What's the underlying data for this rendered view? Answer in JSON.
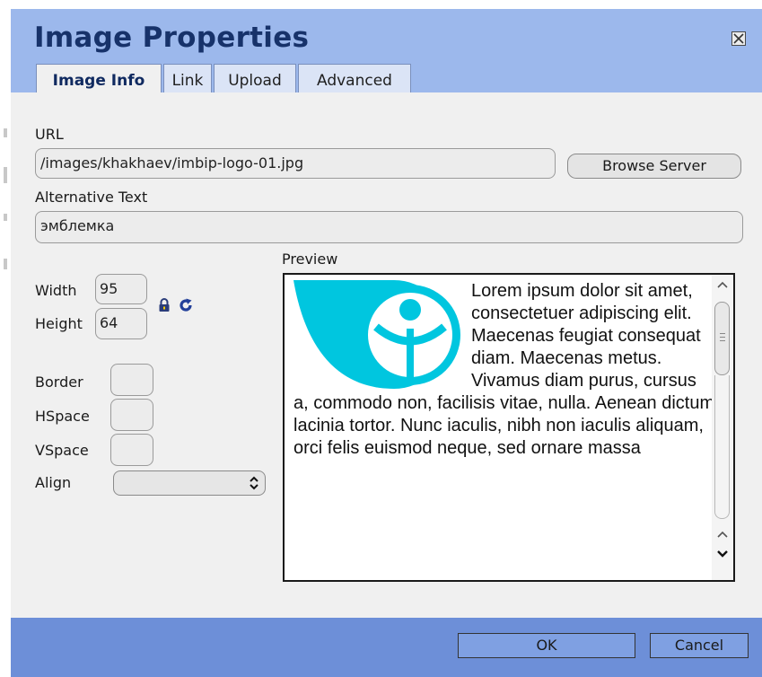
{
  "dialog": {
    "title": "Image Properties"
  },
  "tabs": [
    {
      "label": "Image Info",
      "active": true
    },
    {
      "label": "Link",
      "active": false
    },
    {
      "label": "Upload",
      "active": false
    },
    {
      "label": "Advanced",
      "active": false
    }
  ],
  "url": {
    "label": "URL",
    "value": "/images/khakhaev/imbip-logo-01.jpg",
    "browse_label": "Browse Server"
  },
  "alt": {
    "label": "Alternative Text",
    "value": "эмблемка"
  },
  "dimensions": {
    "width_label": "Width",
    "width_value": "95",
    "height_label": "Height",
    "height_value": "64"
  },
  "spacing": {
    "border_label": "Border",
    "hspace_label": "HSpace",
    "vspace_label": "VSpace",
    "align_label": "Align",
    "align_value": ""
  },
  "preview": {
    "label": "Preview",
    "text": "Lorem ipsum dolor sit amet, consectetuer adipiscing elit. Maecenas feugiat consequat diam. Maecenas metus. Vivamus diam purus, cursus a, commodo non, facilisis vitae, nulla. Aenean dictum lacinia tortor. Nunc iaculis, nibh non iaculis aliquam, orci felis euismod neque, sed ornare massa"
  },
  "footer": {
    "ok_label": "OK",
    "cancel_label": "Cancel"
  },
  "icons": {
    "close": "close-icon",
    "lock": "lock-icon",
    "reset": "reset-size-icon",
    "select": "select-arrows-icon"
  },
  "colors": {
    "title_bar": "#9cb8ec",
    "footer": "#6d8fd8",
    "logo": "#00c6df",
    "title_text": "#17326a"
  }
}
